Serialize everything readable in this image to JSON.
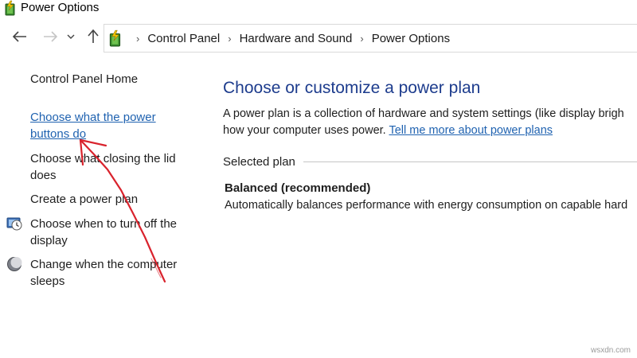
{
  "window": {
    "title": "Power Options"
  },
  "nav": {
    "back_icon": "back-arrow-icon",
    "forward_icon": "forward-arrow-icon",
    "recent_icon": "chevron-down-icon",
    "up_icon": "up-arrow-icon"
  },
  "breadcrumb": {
    "items": [
      "Control Panel",
      "Hardware and Sound",
      "Power Options"
    ],
    "separator": "›"
  },
  "sidebar": {
    "home": "Control Panel Home",
    "items": [
      {
        "label_line1": "Choose what the power",
        "label_line2": "buttons do",
        "icon": ""
      },
      {
        "label_line1": "Choose what closing the lid",
        "label_line2": "does",
        "icon": ""
      },
      {
        "label_line1": "Create a power plan",
        "label_line2": "",
        "icon": ""
      },
      {
        "label_line1": "Choose when to turn off the",
        "label_line2": "display",
        "icon": "display-clock-icon"
      },
      {
        "label_line1": "Change when the computer",
        "label_line2": "sleeps",
        "icon": "sleep-moon-icon"
      }
    ]
  },
  "main": {
    "title": "Choose or customize a power plan",
    "desc_line1": "A power plan is a collection of hardware and system settings (like display brigh",
    "desc_line2_prefix": "how your computer uses power. ",
    "learn_more": "Tell me more about power plans",
    "section_label": "Selected plan",
    "plan_name": "Balanced (recommended)",
    "plan_desc": "Automatically balances performance with energy consumption on capable hard"
  },
  "watermark": "wsxdn.com",
  "colors": {
    "heading": "#1d3c8d",
    "link": "#1f62b0",
    "annotation": "#d9232d"
  }
}
